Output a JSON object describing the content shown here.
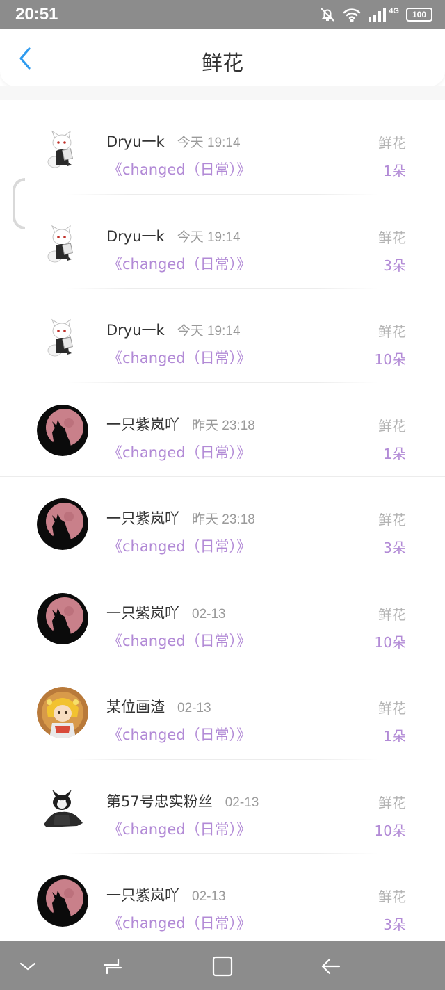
{
  "status_bar": {
    "time": "20:51",
    "network": "4G",
    "battery": "100",
    "icons": [
      "bell-off-icon",
      "wifi-icon",
      "signal-icon",
      "battery-icon"
    ]
  },
  "header": {
    "title": "鲜花",
    "back_icon": "chevron-left-icon"
  },
  "colors": {
    "accent_purple": "#b28ad6",
    "back_blue": "#2f9bef",
    "system_bar_gray": "#8c8c8c"
  },
  "records": [
    {
      "user": "Dryu一k",
      "time": "今天 19:14",
      "title": "《changed（日常）》",
      "gift": "鲜花",
      "count": "1朵",
      "avatar": "white-wolf-avatar"
    },
    {
      "user": "Dryu一k",
      "time": "今天 19:14",
      "title": "《changed（日常）》",
      "gift": "鲜花",
      "count": "3朵",
      "avatar": "white-wolf-avatar"
    },
    {
      "user": "Dryu一k",
      "time": "今天 19:14",
      "title": "《changed（日常）》",
      "gift": "鲜花",
      "count": "10朵",
      "avatar": "white-wolf-avatar"
    },
    {
      "user": "一只紫岚吖",
      "time": "昨天 23:18",
      "title": "《changed（日常）》",
      "gift": "鲜花",
      "count": "1朵",
      "avatar": "wolf-moon-avatar"
    },
    {
      "user": "一只紫岚吖",
      "time": "昨天 23:18",
      "title": "《changed（日常）》",
      "gift": "鲜花",
      "count": "3朵",
      "avatar": "wolf-moon-avatar"
    },
    {
      "user": "一只紫岚吖",
      "time": "02-13",
      "title": "《changed（日常）》",
      "gift": "鲜花",
      "count": "10朵",
      "avatar": "wolf-moon-avatar"
    },
    {
      "user": "某位画渣",
      "time": "02-13",
      "title": "《changed（日常）》",
      "gift": "鲜花",
      "count": "1朵",
      "avatar": "anime-girl-avatar"
    },
    {
      "user": "第57号忠实粉丝",
      "time": "02-13",
      "title": "《changed（日常）》",
      "gift": "鲜花",
      "count": "10朵",
      "avatar": "black-wolf-avatar"
    },
    {
      "user": "一只紫岚吖",
      "time": "02-13",
      "title": "《changed（日常）》",
      "gift": "鲜花",
      "count": "3朵",
      "avatar": "wolf-moon-avatar"
    }
  ],
  "nav_buttons": [
    "chevron-down-icon",
    "recents-icon",
    "home-icon",
    "back-arrow-icon"
  ]
}
